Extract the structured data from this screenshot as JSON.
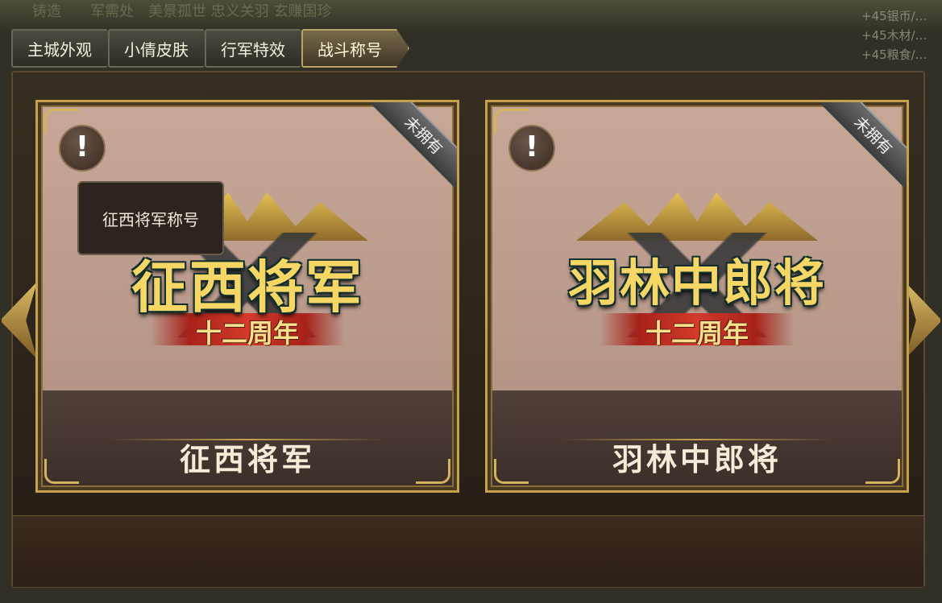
{
  "background": {
    "top_text": "铸造　　军需处　美景孤世 忠义关羽 玄赚国珍",
    "side_lines": [
      "+45银币/...",
      "+45木材/...",
      "+45粮食/..."
    ]
  },
  "tabs": [
    {
      "label": "主城外观",
      "active": false
    },
    {
      "label": "小倩皮肤",
      "active": false
    },
    {
      "label": "行军特效",
      "active": false
    },
    {
      "label": "战斗称号",
      "active": true
    }
  ],
  "cards": [
    {
      "emblem_title": "征西将军",
      "emblem_subtitle": "十二周年",
      "caption": "征西将军",
      "status": "未拥有",
      "info_symbol": "!"
    },
    {
      "emblem_title": "羽林中郎将",
      "emblem_subtitle": "十二周年",
      "caption": "羽林中郎将",
      "status": "未拥有",
      "info_symbol": "!"
    }
  ],
  "tooltip": {
    "text": "征西将军称号"
  },
  "colors": {
    "accent_gold": "#c5a14e",
    "panel_bg": "#2a2119",
    "caption_text": "#f3ecd6"
  }
}
